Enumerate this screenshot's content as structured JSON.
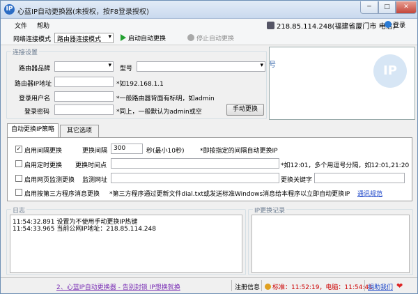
{
  "window": {
    "title": "心蓝IP自动更换器(未授权，按F8登录授权)",
    "app_icon": "IP",
    "minimize_label": "─",
    "maximize_label": "□",
    "close_label": "✕"
  },
  "menu": {
    "items": [
      "文件",
      "帮助"
    ],
    "ip_info": "218.85.114.248(福建省厦门市 电信)",
    "login_label": "登录"
  },
  "toolbar": {
    "mode_label": "网络连接模式",
    "mode_value": "路由器连接模式",
    "start_label": "启动自动更换",
    "stop_label": "停止自动更换"
  },
  "connection": {
    "group_title": "连接设置",
    "router_brand_label": "路由器品牌",
    "router_brand_value": "",
    "model_label": "型号",
    "model_value": "",
    "router_ip_label": "路由器IP地址",
    "router_ip_value": "",
    "router_ip_hint": "*如192.168.1.1",
    "username_label": "登录用户名",
    "username_value": "",
    "username_hint": "*一般路由器背面有标明，如admin",
    "password_label": "登录密码",
    "password_value": "",
    "password_hint": "*同上，一般默认为admin或空",
    "manual_button": "手动更换"
  },
  "ad": {
    "logo_text": "IP",
    "text": "号"
  },
  "tabs": [
    "自动更换IP策略",
    "其它选项"
  ],
  "strategy": {
    "interval": {
      "checked": true,
      "label": "启用间隔更换",
      "field_label": "更换间隔",
      "value": "300",
      "unit": "秒(最小10秒)",
      "hint": "*即按指定的间隔自动更换IP"
    },
    "timed": {
      "checked": false,
      "label": "启用定时更换",
      "field_label": "更换时间点",
      "value": "",
      "hint": "*如12:01，多个用逗号分隔，如12:01,21:20"
    },
    "web": {
      "checked": false,
      "label": "启用网页监测更换",
      "field_label": "监测网址",
      "value": "",
      "keyword_label": "更换关键字",
      "keyword_value": ""
    },
    "thirdparty": {
      "checked": false,
      "label": "启用按第三方程序消息更换",
      "hint": "*第三方程序通过更新文件dial.txt或发送标准Windows消息给本程序以立即自动更换IP",
      "link": "通讯规范"
    }
  },
  "log": {
    "title": "日志",
    "lines": [
      "11:54:32.891  设置为不使用手动更换IP热键",
      "11:54:33.965  当前公网IP地址：218.85.114.248"
    ]
  },
  "ip_records": {
    "title": "IP更换记录"
  },
  "status": {
    "promo": "2、心蓝IP自动更换器 - 告别封锁 IP想换就换",
    "reg_info": "注册信息",
    "standard_time": "标准：11:52:19，电脑：11:54:41",
    "donate": "捐助我们",
    "heart": "❤"
  }
}
